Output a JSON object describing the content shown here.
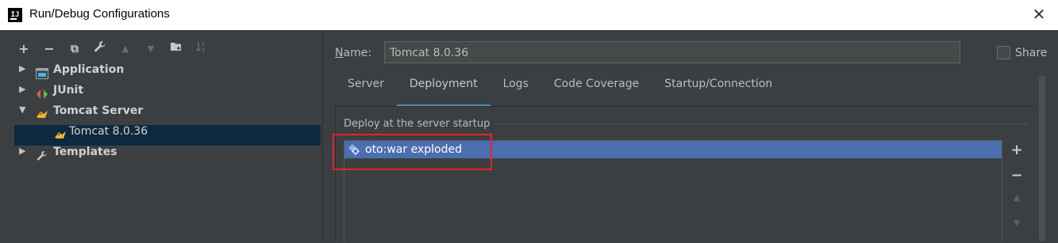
{
  "window": {
    "icon_text": "IJ",
    "title": "Run/Debug Configurations",
    "close_glyph": "✕"
  },
  "toolbar": {
    "buttons": [
      {
        "name": "add-icon",
        "glyph": "+"
      },
      {
        "name": "remove-icon",
        "glyph": "−"
      },
      {
        "name": "copy-icon",
        "glyph": "⧉"
      },
      {
        "name": "wrench-icon",
        "glyph": "🔧"
      },
      {
        "name": "move-up-icon",
        "glyph": "▲"
      },
      {
        "name": "move-down-icon",
        "glyph": "▼"
      },
      {
        "name": "new-folder-icon",
        "glyph": "▣"
      },
      {
        "name": "sort-icon",
        "glyph": "↓"
      }
    ]
  },
  "tree": {
    "items": [
      {
        "label": "Application",
        "arrow": "▶",
        "icon": "application-icon"
      },
      {
        "label": "JUnit",
        "arrow": "▶",
        "icon": "junit-icon"
      },
      {
        "label": "Tomcat Server",
        "arrow": "▼",
        "icon": "tomcat-icon"
      },
      {
        "label": "Tomcat 8.0.36",
        "arrow": "",
        "icon": "tomcat-icon"
      },
      {
        "label": "Templates",
        "arrow": "▶",
        "icon": "wrench-icon"
      }
    ]
  },
  "form": {
    "name_label": "Name:",
    "name_value": "Tomcat 8.0.36",
    "share_label": "Share"
  },
  "tabs": [
    "Server",
    "Deployment",
    "Logs",
    "Code Coverage",
    "Startup/Connection"
  ],
  "active_tab": "Deployment",
  "deployment": {
    "group_title": "Deploy at the server startup",
    "artifacts": [
      "oto:war exploded"
    ],
    "side_buttons": [
      "+",
      "−",
      "▲",
      "▼"
    ]
  },
  "colors": {
    "background": "#3c3f41",
    "selection": "#4b6eaf",
    "tree_selection": "#0d293e",
    "tab_underline": "#4a88c7",
    "highlight_box": "#e8222a"
  }
}
